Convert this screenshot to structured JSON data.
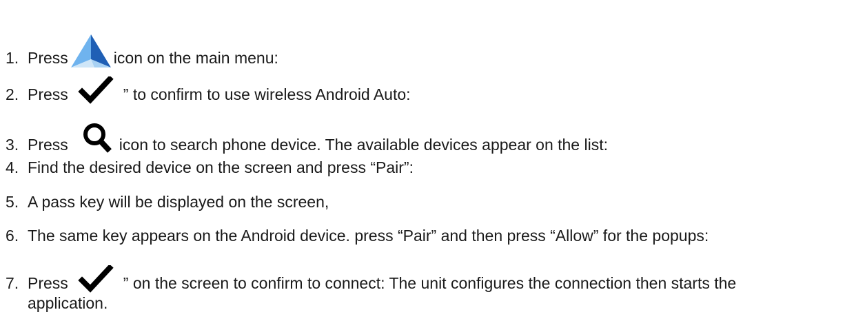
{
  "steps": [
    {
      "number": "1.",
      "before": "Press",
      "icon": "android-auto-icon",
      "after": "icon on the main menu:"
    },
    {
      "number": "2.",
      "before": "Press",
      "icon": "checkmark-icon",
      "after": "” to confirm to use wireless Android Auto:"
    },
    {
      "number": "3.",
      "before": "Press",
      "icon": "search-icon",
      "after": "icon to search phone device. The available devices appear on the list:"
    },
    {
      "number": "4.",
      "text": "Find the desired device on the screen and press “Pair”:"
    },
    {
      "number": "5.",
      "text": "A pass key will be displayed on the screen,"
    },
    {
      "number": "6.",
      "text": "The same key appears on the Android device. press “Pair” and then press “Allow” for the popups:"
    },
    {
      "number": "7.",
      "before": "Press",
      "icon": "checkmark-icon",
      "after": "” on the screen to confirm to connect: The unit configures the connection then starts the",
      "continuation": "application."
    }
  ],
  "colors": {
    "text": "#1a1a1a",
    "android_auto_dark": "#1f5fb5",
    "android_auto_light": "#6fb3ee",
    "android_auto_pale": "#cfe6f8",
    "icon_black": "#000000"
  }
}
